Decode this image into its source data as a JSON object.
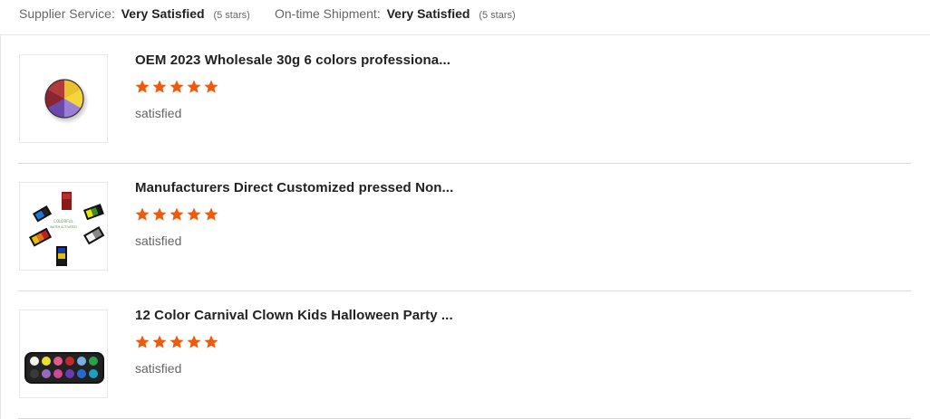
{
  "summary": {
    "supplier_service": {
      "label": "Supplier Service:",
      "value": "Very Satisfied",
      "count": "(5 stars)"
    },
    "ontime_shipment": {
      "label": "On-time Shipment:",
      "value": "Very Satisfied",
      "count": "(5 stars)"
    }
  },
  "colors": {
    "star": "#f05a0a",
    "divider": "#d9d9d9"
  },
  "reviews": [
    {
      "title": "OEM 2023 Wholesale 30g 6 colors professiona...",
      "rating": 5,
      "comment": "satisfied",
      "image_icon": "face-paint-wheel-image"
    },
    {
      "title": "Manufacturers Direct Customized pressed Non...",
      "rating": 5,
      "comment": "satisfied",
      "image_icon": "split-cake-palettes-image"
    },
    {
      "title": "12 Color Carnival Clown Kids Halloween Party ...",
      "rating": 5,
      "comment": "satisfied",
      "image_icon": "face-paint-palette-image"
    }
  ]
}
